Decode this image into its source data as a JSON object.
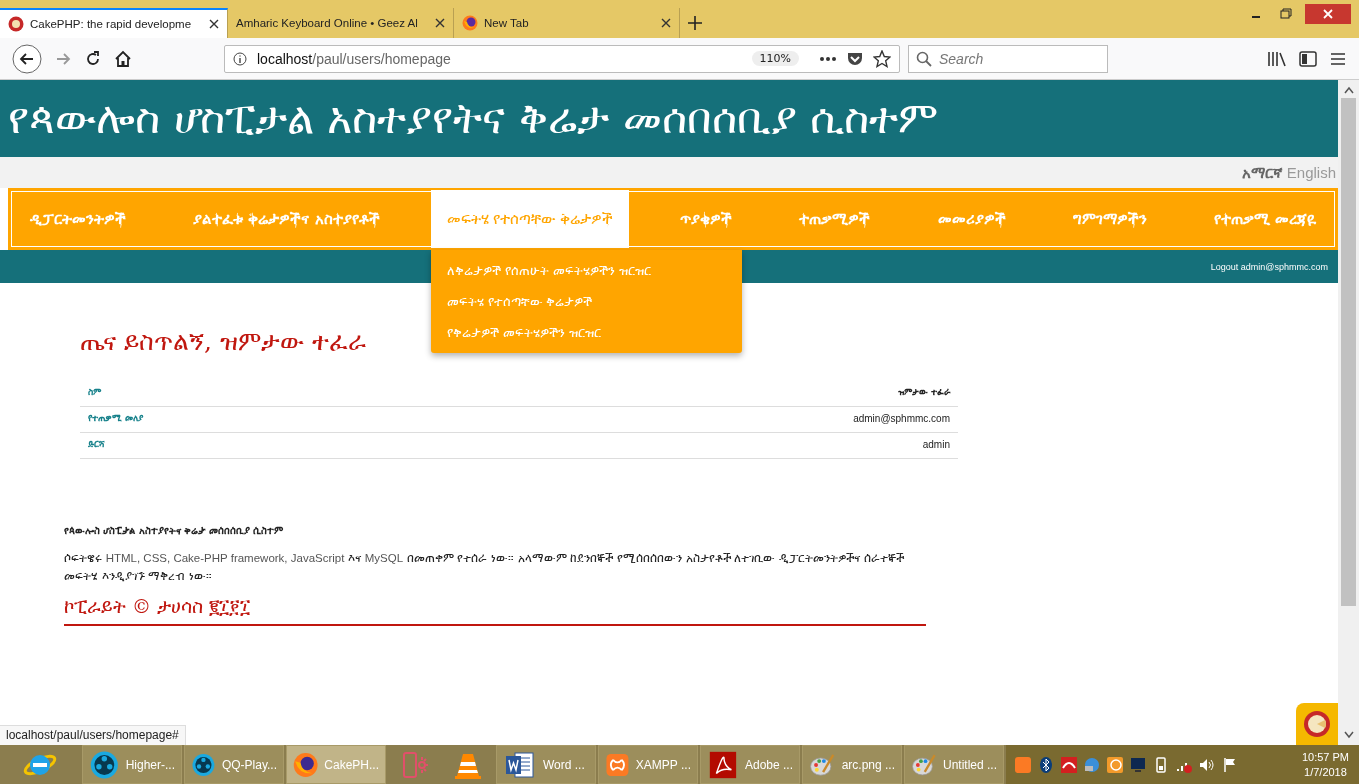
{
  "browser": {
    "tabs": [
      {
        "title": "CakePHP: the rapid developme",
        "selected": true,
        "kind": "cake"
      },
      {
        "title": "Amharic Keyboard Online • Geez Al",
        "selected": false,
        "kind": "none"
      },
      {
        "title": "New Tab",
        "selected": false,
        "kind": "firefox"
      }
    ],
    "address": {
      "host": "localhost",
      "path": "/paul/users/homepage"
    },
    "zoom": "110%",
    "search_placeholder": "Search"
  },
  "page": {
    "site_title": "የጳውሎስ ሆስፒታል አስተያየትና ቅሬታ መሰበሰቢያ ሲስተም",
    "languages": [
      {
        "label": "አማርኛ",
        "selected": true
      },
      {
        "label": "English",
        "selected": false
      }
    ],
    "nav": [
      {
        "label": "ዲፓርትመንትዎች",
        "selected": false
      },
      {
        "label": "ያልተፈቱ ቅሬታዎችና አስተያየቶች",
        "selected": false
      },
      {
        "label": "መፍትሄ የተሰጣቸው ቅሬታዎች",
        "selected": true
      },
      {
        "label": "ጥያቄዎች",
        "selected": false
      },
      {
        "label": "ተጠቃሚዎች",
        "selected": false
      },
      {
        "label": "መመሪያዎች",
        "selected": false
      },
      {
        "label": "ግምገማዎችን",
        "selected": false
      },
      {
        "label": "የተጠቃሚ መረጃዬ",
        "selected": false
      }
    ],
    "dropdown": [
      "ለቅሬታዎች የሰጠሁት መፍትሄዎችን ዝርዝር",
      "መፍትሄ የተሰጣቸው ቅሬታዎች",
      "የቅሬታዎች መፍትሄዎችን ዝርዝር"
    ],
    "logout": "Logout admin@sphmmc.com",
    "greeting": "ጤና ይስጥልኝ, ዝምታው ተፈራ",
    "profile": [
      {
        "label": "ስም",
        "value": "ዝምታው ተፈራ"
      },
      {
        "label": "የተጠቃሚ መለያ",
        "value": "admin@sphmmc.com"
      },
      {
        "label": "ድርሻ",
        "value": "admin"
      }
    ],
    "footer": {
      "title": "የጳውሎስ ሆስፒታል አስተያየትና ቅሬታ መሰበሰቢያ ሲስተም",
      "description": [
        {
          "text": "ሶፍትዌሩ ",
          "kind": "plain"
        },
        {
          "text": "HTML, CSS, Cake-PHP framework, JavaScript",
          "kind": "tech"
        },
        {
          "text": " እና ",
          "kind": "plain"
        },
        {
          "text": "MySQL",
          "kind": "tech"
        },
        {
          "text": " በመጠቀም የተሰራ ነው። አላማውም ከደንበኞች የሚሰበሰበውን አስታየቶች ለተገቢው ዲፓርትመንትዎችና ሰራተኞች መፍትሄ እንዲያገኙ ማቅረብ ነው።",
          "kind": "plain"
        }
      ],
      "copyright": "ኮፒራይት © ታሀሳስ ፪፲፻፲"
    }
  },
  "status_url": "localhost/paul/users/homepage#",
  "taskbar": {
    "items": [
      {
        "kind": "ie",
        "selected": false
      },
      {
        "kind": "media",
        "label": "Higher-...",
        "selected": false
      },
      {
        "kind": "media",
        "label": "QQ-Play...",
        "selected": false
      },
      {
        "kind": "firefox",
        "label": "CakePH...",
        "selected": true
      },
      {
        "kind": "phone",
        "selected": false
      },
      {
        "kind": "vlc",
        "selected": false
      },
      {
        "kind": "word",
        "label": "Word ...",
        "selected": false
      },
      {
        "kind": "xampp",
        "label": "XAMPP ...",
        "selected": false
      },
      {
        "kind": "adobe",
        "label": "Adobe ...",
        "selected": false
      },
      {
        "kind": "paint",
        "label": "arc.png ...",
        "selected": false
      },
      {
        "kind": "paint",
        "label": "Untitled ...",
        "selected": false
      }
    ],
    "time": "10:57 PM",
    "date": "1/7/2018"
  }
}
